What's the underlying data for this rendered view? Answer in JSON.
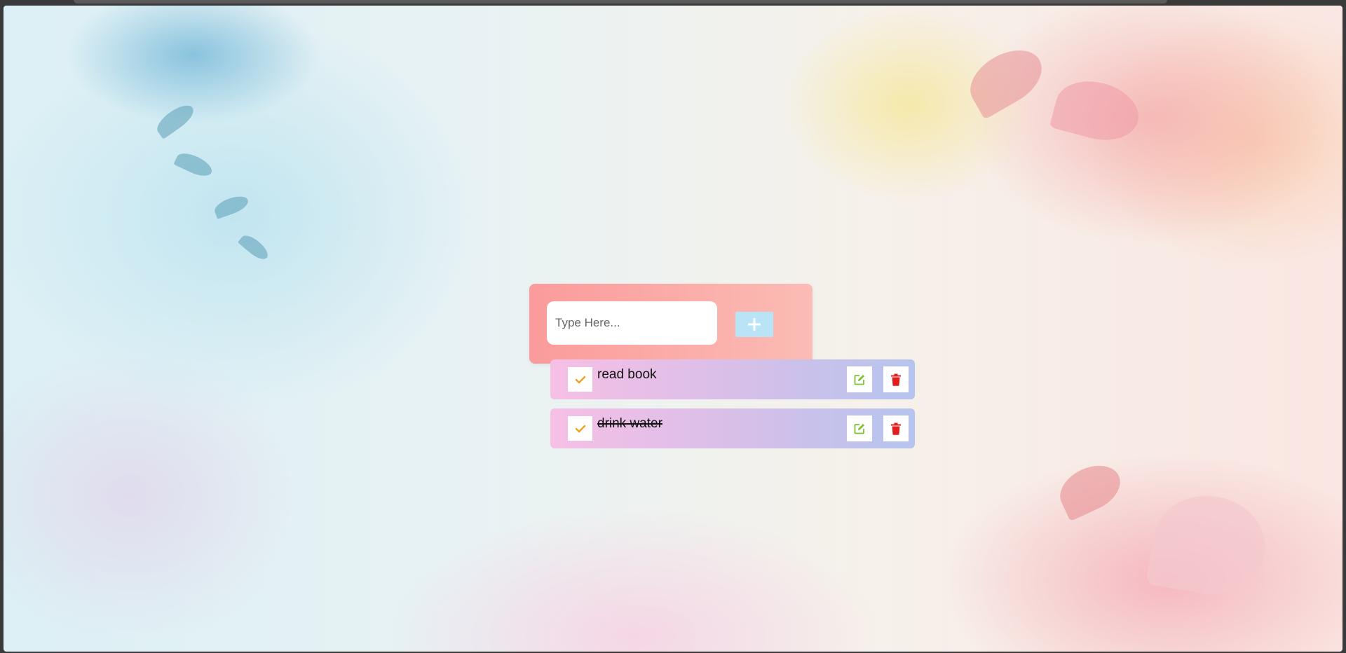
{
  "input": {
    "placeholder": "Type Here...",
    "value": ""
  },
  "add_button": {
    "icon": "plus-icon"
  },
  "todos": [
    {
      "text": "read book",
      "completed": false
    },
    {
      "text": "drink water",
      "completed": true
    }
  ],
  "colors": {
    "card_gradient": [
      "#fb9b9b",
      "#fbbcb5"
    ],
    "item_gradient": [
      "#f7bfe6",
      "#d8bfe8",
      "#b5c4ee"
    ],
    "add_button": "#b9e4f7",
    "check_icon": "#f0a020",
    "edit_icon": "#7cc232",
    "delete_icon": "#e31c1c"
  },
  "icons": {
    "check": "check-icon",
    "edit": "edit-icon",
    "delete": "trash-icon"
  }
}
